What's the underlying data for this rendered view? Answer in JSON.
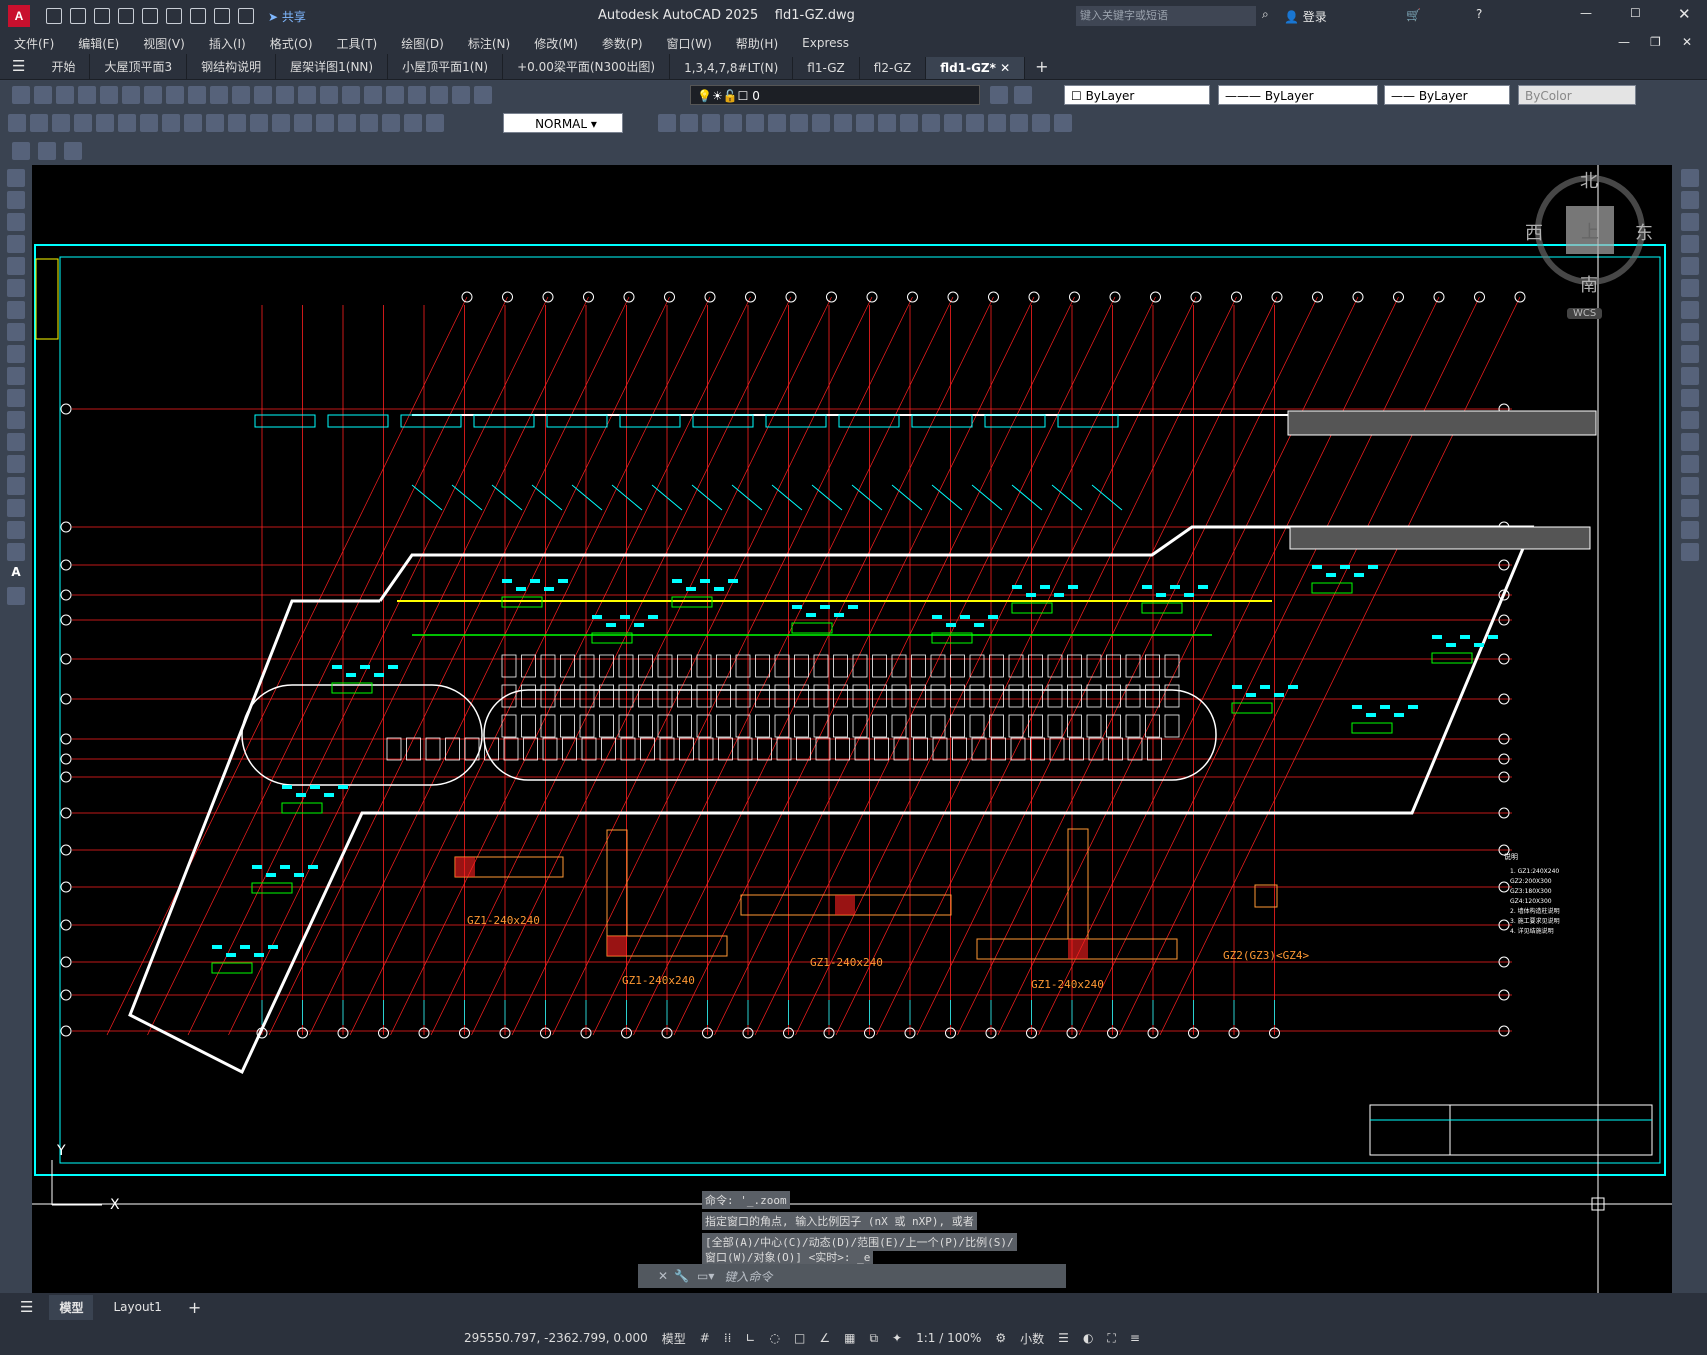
{
  "app": {
    "name": "Autodesk AutoCAD 2025",
    "file": "fld1-GZ.dwg",
    "logo": "A"
  },
  "titlebar": {
    "share": "共享",
    "search_placeholder": "键入关键字或短语",
    "login": "登录"
  },
  "menu": [
    "文件(F)",
    "编辑(E)",
    "视图(V)",
    "插入(I)",
    "格式(O)",
    "工具(T)",
    "绘图(D)",
    "标注(N)",
    "修改(M)",
    "参数(P)",
    "窗口(W)",
    "帮助(H)",
    "Express"
  ],
  "tabs": [
    {
      "label": "开始",
      "active": false
    },
    {
      "label": "大屋顶平面3",
      "active": false
    },
    {
      "label": "钢结构说明",
      "active": false
    },
    {
      "label": "屋架详图1(NN)",
      "active": false
    },
    {
      "label": "小屋顶平面1(N)",
      "active": false
    },
    {
      "label": "+0.00梁平面(N300出图)",
      "active": false
    },
    {
      "label": "1,3,4,7,8#LT(N)",
      "active": false
    },
    {
      "label": "fl1-GZ",
      "active": false
    },
    {
      "label": "fl2-GZ",
      "active": false
    },
    {
      "label": "fld1-GZ*",
      "active": true
    }
  ],
  "properties": {
    "layer": "0",
    "color": "ByLayer",
    "linetype": "ByLayer",
    "lineweight": "ByLayer",
    "plotstyle": "ByColor",
    "dimstyle": "NORMAL"
  },
  "viewcube": {
    "north": "北",
    "south": "南",
    "east": "东",
    "west": "西",
    "top": "上",
    "wcs": "WCS"
  },
  "drawing": {
    "details": [
      "GZ1-240x240",
      "GZ1-240x240",
      "GZ1-240x240",
      "GZ1-240x240",
      "GZ2(GZ3)<GZ4>"
    ],
    "notes_title": "说明",
    "notes": [
      "1. GZ1:240X240",
      "GZ2:200X300",
      "GZ3:180X300",
      "GZ4:120X300",
      "2. 墙体构造柱说明",
      "3. 施工要求见说明",
      "4. 详见结施说明"
    ],
    "ucs_y": "Y",
    "ucs_x": "X"
  },
  "command": {
    "history": [
      "命令: '_.zoom",
      "指定窗口的角点, 输入比例因子 (nX 或 nXP), 或者",
      "[全部(A)/中心(C)/动态(D)/范围(E)/上一个(P)/比例(S)/",
      "窗口(W)/对象(O)] <实时>: _e"
    ],
    "placeholder": "键入命令"
  },
  "layout_tabs": [
    {
      "label": "模型",
      "active": true
    },
    {
      "label": "Layout1",
      "active": false
    }
  ],
  "status": {
    "coords": "295550.797, -2362.799, 0.000",
    "model": "模型",
    "scale": "1:1 / 100%",
    "units": "小数"
  },
  "colors": {
    "accent": "#c8102e",
    "cyan": "#00ffff",
    "red": "#ff2020",
    "yellow": "#ffff00",
    "green": "#00ff00",
    "white": "#ffffff",
    "orange": "#ff9933"
  }
}
